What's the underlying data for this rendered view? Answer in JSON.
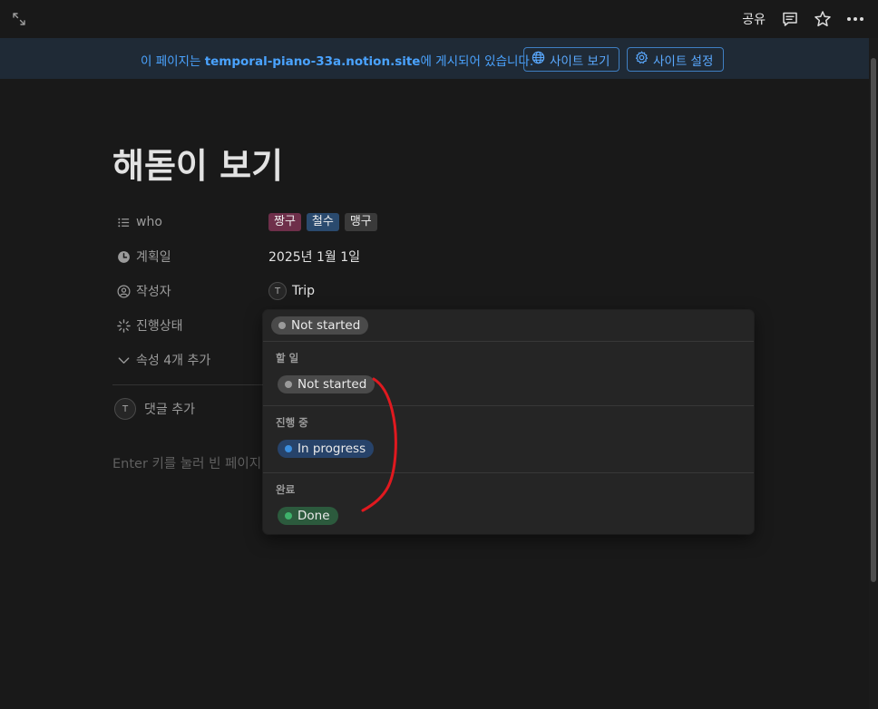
{
  "topbar": {
    "share_label": "공유",
    "icons": [
      "expand-icon",
      "comment-icon",
      "star-icon",
      "more-icon"
    ]
  },
  "banner": {
    "text_prefix": "이 페이지는 ",
    "site": "temporal-piano-33a.notion.site",
    "text_suffix": "에 게시되어 있습니다.",
    "view_site_label": "사이트 보기",
    "site_settings_label": "사이트 설정"
  },
  "page": {
    "title": "해돋이 보기",
    "properties": {
      "who": {
        "label": "who",
        "tags": [
          "짱구",
          "철수",
          "맹구"
        ]
      },
      "planned_date": {
        "label": "계획일",
        "value": "2025년 1월 1일"
      },
      "author": {
        "label": "작성자",
        "initial": "T",
        "value": "Trip"
      },
      "status": {
        "label": "진행상태"
      },
      "more": {
        "label": "속성 4개 추가"
      }
    },
    "comment": {
      "initial": "T",
      "label": "댓글 추가"
    },
    "body_placeholder": "Enter 키를 눌러 빈 페이지"
  },
  "status_dropdown": {
    "current": "Not started",
    "groups": [
      {
        "heading": "할 일",
        "option": "Not started",
        "dot_color": "#9b9b9b",
        "pill_color": "#4a4a4a"
      },
      {
        "heading": "진행 중",
        "option": "In progress",
        "dot_color": "#3b8fe0",
        "pill_color": "#27436a"
      },
      {
        "heading": "완료",
        "option": "Done",
        "dot_color": "#3fb26b",
        "pill_color": "#2c5a3d"
      }
    ]
  },
  "colors": {
    "background": "#191919",
    "banner_bg": "#1f2a36",
    "link_blue": "#4aa3ff",
    "annotation_red": "#e0191f"
  }
}
